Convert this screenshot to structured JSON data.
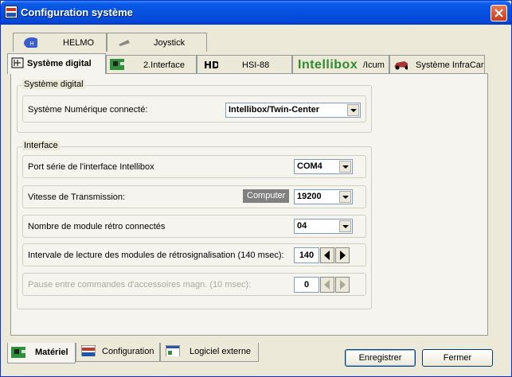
{
  "window": {
    "title": "Configuration système"
  },
  "tabs_row1": [
    {
      "label": "HELMO",
      "icon": "helmo-logo-icon"
    },
    {
      "label": "Joystick",
      "icon": "joystick-icon"
    }
  ],
  "tabs_row2": [
    {
      "label": "Système digital",
      "icon": "digital-system-icon"
    },
    {
      "label": "2.Interface",
      "icon": "circuit-board-icon"
    },
    {
      "label": "HSI-88",
      "icon": "hsi-icon"
    },
    {
      "label": "/Icum",
      "logo_text": "Intellibox",
      "icon": "intellibox-logo"
    },
    {
      "label": "Système InfraCar",
      "icon": "car-icon"
    }
  ],
  "group_digital": {
    "title": "Système digital",
    "row_label": "Système Numérique connecté:",
    "value": "Intellibox/Twin-Center"
  },
  "group_interface": {
    "title": "Interface",
    "rows": [
      {
        "label": "Port série de l'interface Intellibox",
        "value": "COM4"
      },
      {
        "label": "Vitesse de Transmission:",
        "button": "Computer",
        "value": "19200"
      },
      {
        "label": "Nombre de module rétro connectés",
        "value": "04"
      },
      {
        "label": "Intervale de lecture des modules de rétrosignalisation (140 msec):",
        "value": "140"
      },
      {
        "label": "Pause entre commandes d'accessoires magn. (10 msec):",
        "value": "0"
      }
    ]
  },
  "bottom_tabs": [
    {
      "label": "Matériel",
      "icon": "hardware-icon"
    },
    {
      "label": "Configuration",
      "icon": "wdp-icon"
    },
    {
      "label": "Logiciel externe",
      "icon": "window-icon"
    }
  ],
  "buttons": {
    "save": "Enregistrer",
    "close": "Fermer"
  }
}
